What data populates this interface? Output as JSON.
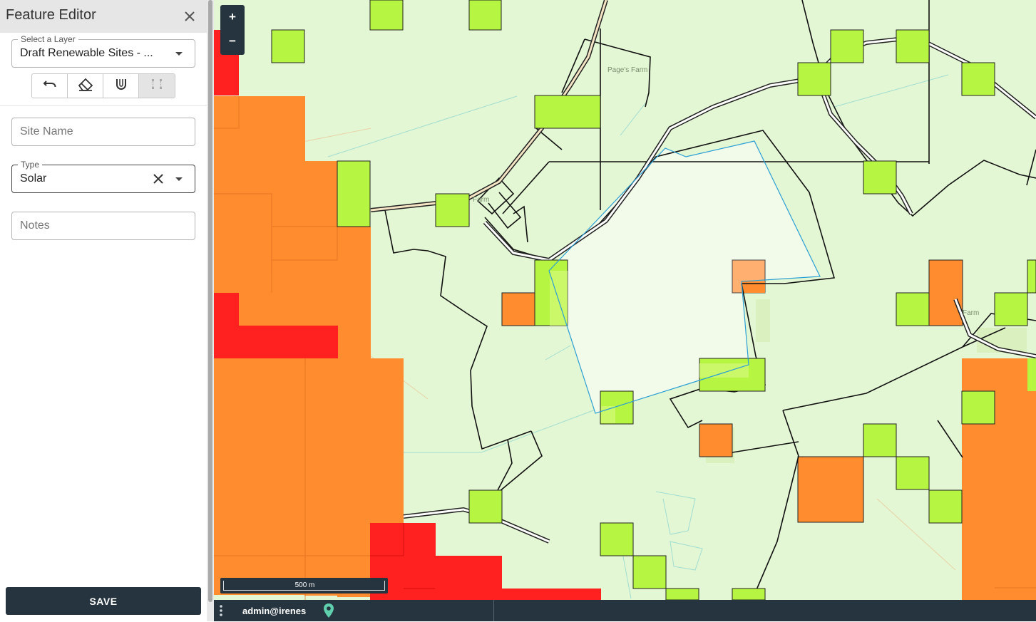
{
  "sidebar": {
    "title": "Feature Editor",
    "layer_select": {
      "legend": "Select a Layer",
      "value": "Draft Renewable Sites - ..."
    },
    "tools": [
      {
        "name": "undo-icon"
      },
      {
        "name": "eraser-icon"
      },
      {
        "name": "magnet-icon"
      },
      {
        "name": "vertex-edit-icon"
      }
    ],
    "site_name": {
      "placeholder": "Site Name"
    },
    "type": {
      "legend": "Type",
      "value": "Solar"
    },
    "notes": {
      "placeholder": "Notes"
    },
    "save_label": "SAVE"
  },
  "map": {
    "zoom_in_label": "+",
    "zoom_out_label": "−",
    "scale_label": "500 m",
    "place_labels": [
      "Page's Farm",
      "Farm",
      "Farm"
    ],
    "colors": {
      "background": "#e4f7d4",
      "selected_field": "#f1fbe8",
      "lime_cell": "#b6f542",
      "orange_cell": "#ff8c2e",
      "red_cell": "#ff2020",
      "selection_outline": "#2a9fd6"
    }
  },
  "status": {
    "user": "admin@irenes"
  }
}
